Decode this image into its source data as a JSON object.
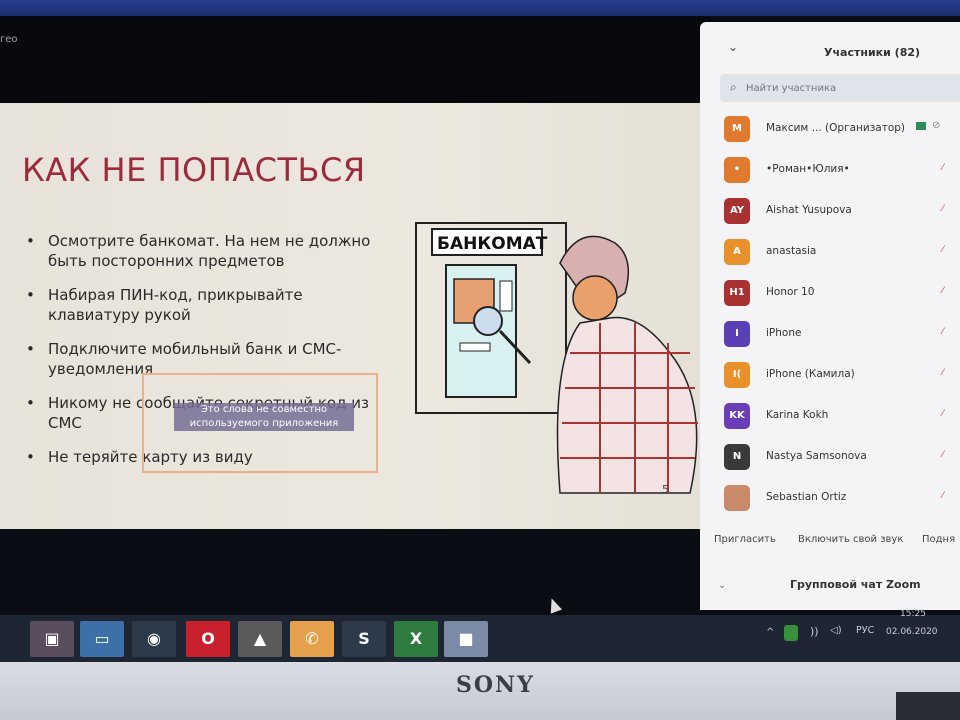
{
  "app": {
    "window_title_fragment": "гео"
  },
  "slide": {
    "title": "КАК НЕ ПОПАСТЬСЯ",
    "bullets": [
      "Осмотрите банкомат. На нем не должно быть посторонних предметов",
      "Набирая ПИН-код, прикрывайте клавиатуру рукой",
      "Подключите мобильный банк и СМС-уведомления",
      "Никому не сообщайте секретный код из СМС",
      "Не теряйте карту из виду"
    ],
    "atm_sign": "БАНКОМАТ",
    "note": "Это слова не совместно используемого приложения",
    "page_number": "5"
  },
  "participants_panel": {
    "title": "Участники (82)",
    "search_placeholder": "Найти участника",
    "participants": [
      {
        "initials": "M",
        "name": "Максим ... (Организатор)",
        "color": "#e07a2e",
        "host": true
      },
      {
        "initials": "•",
        "name": "•Роман•Юлия•",
        "color": "#e07a2e"
      },
      {
        "initials": "AY",
        "name": "Aishat Yusupova",
        "color": "#a83232"
      },
      {
        "initials": "A",
        "name": "anastasia",
        "color": "#e8902c"
      },
      {
        "initials": "H1",
        "name": "Honor 10",
        "color": "#a83232"
      },
      {
        "initials": "I",
        "name": "iPhone",
        "color": "#5b3fb5"
      },
      {
        "initials": "I(",
        "name": "iPhone (Камила)",
        "color": "#e8902c"
      },
      {
        "initials": "KK",
        "name": "Karina Kokh",
        "color": "#6a3fb5"
      },
      {
        "initials": "N",
        "name": "Nastya Samsonova",
        "color": "#3a3a3a"
      },
      {
        "initials": "",
        "name": "Sebastian Ortiz",
        "color": "#c98a6a"
      }
    ],
    "actions": {
      "invite": "Пригласить",
      "unmute": "Включить свой звук",
      "raise": "Подня"
    },
    "chat_label": "Групповой чат Zoom"
  },
  "taskbar": {
    "apps": [
      {
        "name": "photo-app",
        "glyph": "▣",
        "color": "#5a4d5e"
      },
      {
        "name": "file-explorer",
        "glyph": "▭",
        "color": "#3d6fa8"
      },
      {
        "name": "chrome",
        "glyph": "◉",
        "color": "#2d3a4a"
      },
      {
        "name": "opera",
        "glyph": "O",
        "color": "#c8202c"
      },
      {
        "name": "batman-app",
        "glyph": "▲",
        "color": "#5a5a5a"
      },
      {
        "name": "viber",
        "glyph": "✆",
        "color": "#e4a04a"
      },
      {
        "name": "skype",
        "glyph": "S",
        "color": "#2d3a4a"
      },
      {
        "name": "excel",
        "glyph": "X",
        "color": "#2f7d3e"
      },
      {
        "name": "zoom",
        "glyph": "■",
        "color": "#7b8aa6"
      }
    ],
    "language": "РУС",
    "time": "15:25",
    "date": "02.06.2020"
  },
  "bezel": {
    "brand": "SONY"
  }
}
